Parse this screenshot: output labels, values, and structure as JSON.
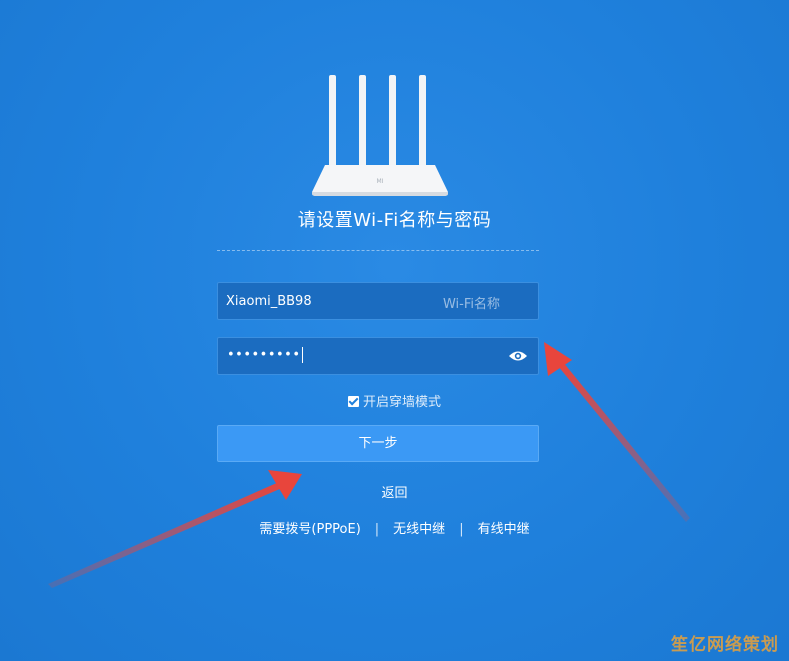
{
  "setup": {
    "title": "请设置Wi-Fi名称与密码",
    "router_label": "MI",
    "ssid": {
      "value": "Xiaomi_BB98",
      "hint": "Wi-Fi名称"
    },
    "password": {
      "masked_value": "•••••••••",
      "toggle_icon": "eye-icon"
    },
    "wall_mode": {
      "checked": true,
      "label": "开启穿墙模式"
    },
    "next_button": "下一步",
    "back_link": "返回",
    "links": {
      "pppoe": "需要拨号(PPPoE)",
      "separator": "|",
      "wireless_relay": "无线中继",
      "wired_relay": "有线中继"
    }
  },
  "annotations": {
    "arrow_color": "#e8453c"
  },
  "watermark": "笙亿网络策划",
  "colors": {
    "background": "#1f80dc",
    "input_bg": "#1b6cc0",
    "button_bg": "#3b99f5"
  }
}
